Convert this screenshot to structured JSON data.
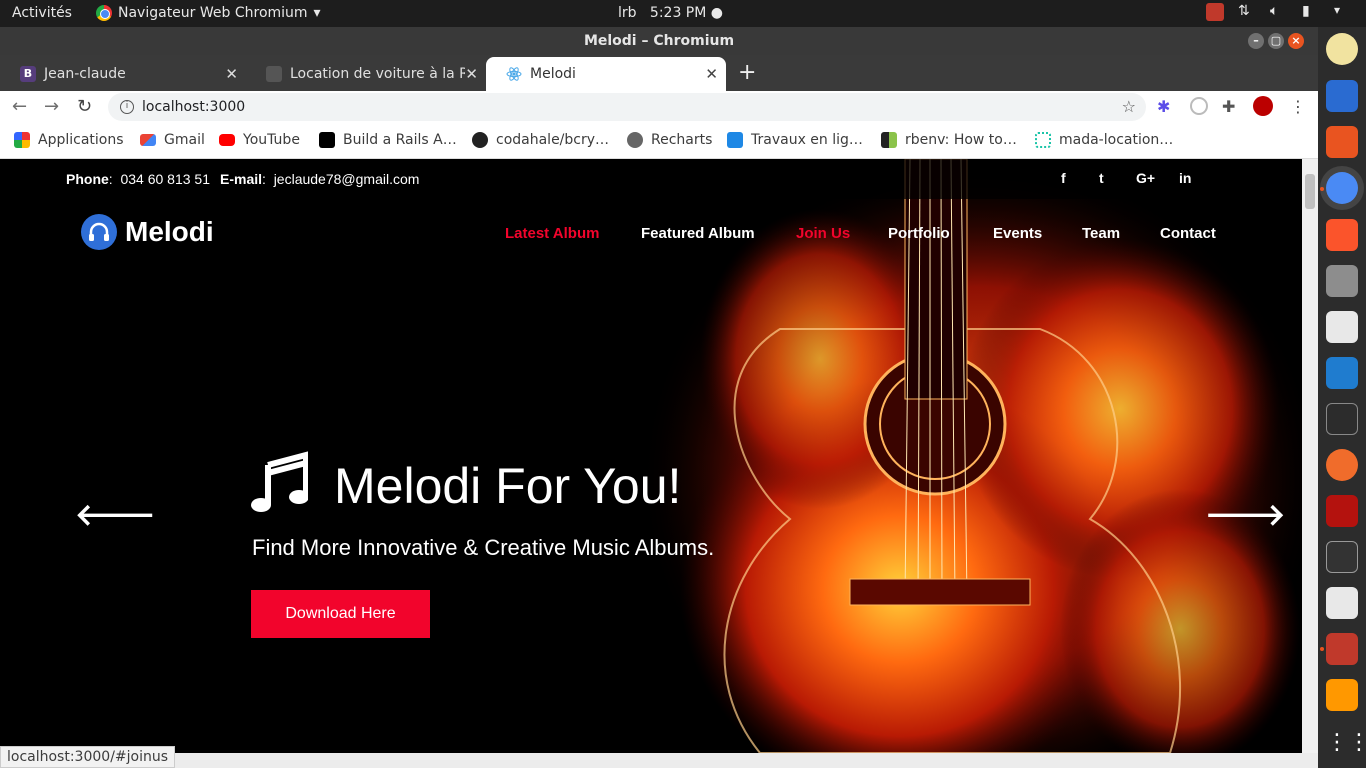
{
  "system": {
    "activities": "Activités",
    "app_menu": "Navigateur Web Chromium",
    "user": "lrb",
    "clock": "5:23 PM"
  },
  "window": {
    "title": "Melodi – Chromium"
  },
  "tabs": [
    {
      "label": "Jean-claude",
      "favicon": "B",
      "favicon_color": "#563d7c"
    },
    {
      "label": "Location de voiture à la R",
      "favicon": "",
      "favicon_color": "#555555"
    },
    {
      "label": "Melodi",
      "favicon": "react-icon",
      "favicon_color": "#61dafb"
    }
  ],
  "address_bar": {
    "url": "localhost:3000"
  },
  "bookmarks": [
    {
      "label": "Applications",
      "icon": "apps-grid-icon"
    },
    {
      "label": "Gmail",
      "icon": "gmail-icon"
    },
    {
      "label": "YouTube",
      "icon": "youtube-icon"
    },
    {
      "label": "Build a Rails A…",
      "icon": "medium-icon"
    },
    {
      "label": "codahale/bcry…",
      "icon": "github-icon"
    },
    {
      "label": "Recharts",
      "icon": "globe-icon"
    },
    {
      "label": "Travaux en lig…",
      "icon": "bookmark-icon"
    },
    {
      "label": "rbenv: How to…",
      "icon": "bookmark-icon"
    },
    {
      "label": "mada-location…",
      "icon": "bookmark-icon"
    }
  ],
  "site": {
    "contact": {
      "phone_label": "Phone",
      "phone": "034 60 813 51",
      "email_label": "E-mail",
      "email": "jeclaude78@gmail.com"
    },
    "social": [
      "f",
      "t",
      "G+",
      "in"
    ],
    "logo": "Melodi",
    "nav": [
      "Latest Album",
      "Featured Album",
      "Join Us",
      "Portfolio",
      "Events",
      "Team",
      "Contact"
    ],
    "hero": {
      "title": "Melodi For You!",
      "subtitle": "Find More Innovative & Creative Music Albums.",
      "button": "Download Here"
    },
    "accent": "#f2042c"
  },
  "status_url": "localhost:3000/#joinus"
}
